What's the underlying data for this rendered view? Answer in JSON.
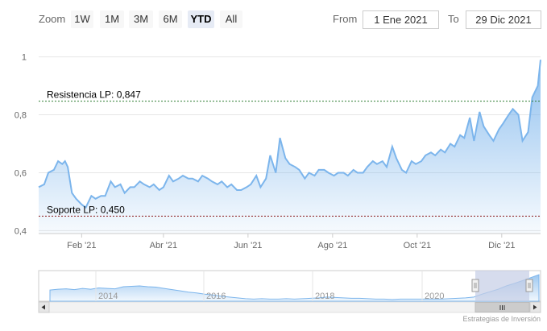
{
  "toolbar": {
    "zoom_label": "Zoom",
    "zoom_buttons": [
      "1W",
      "1M",
      "3M",
      "6M",
      "YTD",
      "All"
    ],
    "active_zoom": "YTD",
    "from_label": "From",
    "from_value": "1 Ene 2021",
    "to_label": "To",
    "to_value": "29 Dic 2021"
  },
  "colors": {
    "series_line": "#7cb5ec",
    "resistance_line": "#2e7d32",
    "support_line": "#8b1a1a",
    "navigator_mask": "#c5cde6"
  },
  "credit": "Estrategias de Inversión",
  "chart_data": {
    "type": "area",
    "title": "",
    "xlabel": "",
    "ylabel": "",
    "x_tick_labels": [
      "Feb '21",
      "Abr '21",
      "Jun '21",
      "Ago '21",
      "Oct '21",
      "Dic '21"
    ],
    "y_tick_labels": [
      "0,4",
      "0,6",
      "0,8",
      "1"
    ],
    "ylim": [
      0.4,
      1.0
    ],
    "grid": true,
    "plot_lines": [
      {
        "label": "Resistencia LP: 0,847",
        "value": 0.847
      },
      {
        "label": "Soporte LP: 0,450",
        "value": 0.45
      }
    ],
    "series": [
      {
        "x": [
          "2021-01-01",
          "2021-01-05",
          "2021-01-08",
          "2021-01-12",
          "2021-01-15",
          "2021-01-18",
          "2021-01-20",
          "2021-01-22",
          "2021-01-25",
          "2021-01-28",
          "2021-02-01",
          "2021-02-04",
          "2021-02-08",
          "2021-02-11",
          "2021-02-15",
          "2021-02-18",
          "2021-02-22",
          "2021-02-25",
          "2021-03-01",
          "2021-03-04",
          "2021-03-08",
          "2021-03-11",
          "2021-03-15",
          "2021-03-18",
          "2021-03-22",
          "2021-03-25",
          "2021-03-29",
          "2021-04-01",
          "2021-04-05",
          "2021-04-08",
          "2021-04-12",
          "2021-04-15",
          "2021-04-19",
          "2021-04-22",
          "2021-04-26",
          "2021-04-29",
          "2021-05-03",
          "2021-05-06",
          "2021-05-10",
          "2021-05-13",
          "2021-05-17",
          "2021-05-20",
          "2021-05-24",
          "2021-05-27",
          "2021-05-31",
          "2021-06-03",
          "2021-06-07",
          "2021-06-10",
          "2021-06-14",
          "2021-06-17",
          "2021-06-21",
          "2021-06-24",
          "2021-06-28",
          "2021-07-01",
          "2021-07-05",
          "2021-07-08",
          "2021-07-12",
          "2021-07-15",
          "2021-07-19",
          "2021-07-22",
          "2021-07-26",
          "2021-07-29",
          "2021-08-02",
          "2021-08-05",
          "2021-08-09",
          "2021-08-12",
          "2021-08-16",
          "2021-08-19",
          "2021-08-23",
          "2021-08-26",
          "2021-08-30",
          "2021-09-02",
          "2021-09-06",
          "2021-09-09",
          "2021-09-13",
          "2021-09-16",
          "2021-09-20",
          "2021-09-23",
          "2021-09-27",
          "2021-09-30",
          "2021-10-04",
          "2021-10-07",
          "2021-10-11",
          "2021-10-14",
          "2021-10-18",
          "2021-10-21",
          "2021-10-25",
          "2021-10-28",
          "2021-11-01",
          "2021-11-04",
          "2021-11-08",
          "2021-11-11",
          "2021-11-15",
          "2021-11-18",
          "2021-11-22",
          "2021-11-25",
          "2021-11-29",
          "2021-12-02",
          "2021-12-06",
          "2021-12-09",
          "2021-12-13",
          "2021-12-16",
          "2021-12-20",
          "2021-12-23",
          "2021-12-27",
          "2021-12-29"
        ],
        "values": [
          0.55,
          0.56,
          0.6,
          0.61,
          0.64,
          0.63,
          0.64,
          0.62,
          0.53,
          0.51,
          0.49,
          0.48,
          0.52,
          0.51,
          0.52,
          0.52,
          0.57,
          0.55,
          0.56,
          0.53,
          0.55,
          0.55,
          0.57,
          0.56,
          0.55,
          0.56,
          0.54,
          0.55,
          0.59,
          0.57,
          0.58,
          0.59,
          0.58,
          0.58,
          0.57,
          0.59,
          0.58,
          0.57,
          0.56,
          0.57,
          0.55,
          0.56,
          0.54,
          0.54,
          0.55,
          0.56,
          0.59,
          0.55,
          0.58,
          0.66,
          0.6,
          0.72,
          0.65,
          0.63,
          0.62,
          0.61,
          0.58,
          0.6,
          0.59,
          0.61,
          0.61,
          0.6,
          0.59,
          0.6,
          0.6,
          0.59,
          0.61,
          0.6,
          0.6,
          0.62,
          0.64,
          0.63,
          0.64,
          0.62,
          0.69,
          0.65,
          0.61,
          0.6,
          0.64,
          0.63,
          0.64,
          0.66,
          0.67,
          0.66,
          0.68,
          0.67,
          0.7,
          0.69,
          0.73,
          0.72,
          0.79,
          0.71,
          0.81,
          0.76,
          0.73,
          0.71,
          0.75,
          0.77,
          0.8,
          0.82,
          0.8,
          0.71,
          0.74,
          0.86,
          0.9,
          0.99
        ]
      }
    ],
    "navigator": {
      "tick_labels": [
        "2014",
        "2016",
        "2018",
        "2020"
      ],
      "values": [
        0.62,
        0.64,
        0.65,
        0.63,
        0.66,
        0.64,
        0.67,
        0.66,
        0.65,
        0.7,
        0.71,
        0.72,
        0.7,
        0.69,
        0.66,
        0.63,
        0.6,
        0.57,
        0.55,
        0.52,
        0.5,
        0.47,
        0.45,
        0.43,
        0.41,
        0.4,
        0.41,
        0.4,
        0.4,
        0.41,
        0.4,
        0.41,
        0.42,
        0.43,
        0.45,
        0.44,
        0.43,
        0.42,
        0.42,
        0.41,
        0.4,
        0.4,
        0.39,
        0.4,
        0.4,
        0.4,
        0.4,
        0.4,
        0.4,
        0.41,
        0.42,
        0.43,
        0.45,
        0.52,
        0.58,
        0.64,
        0.72,
        0.78,
        0.85,
        0.92,
        0.99
      ]
    }
  }
}
